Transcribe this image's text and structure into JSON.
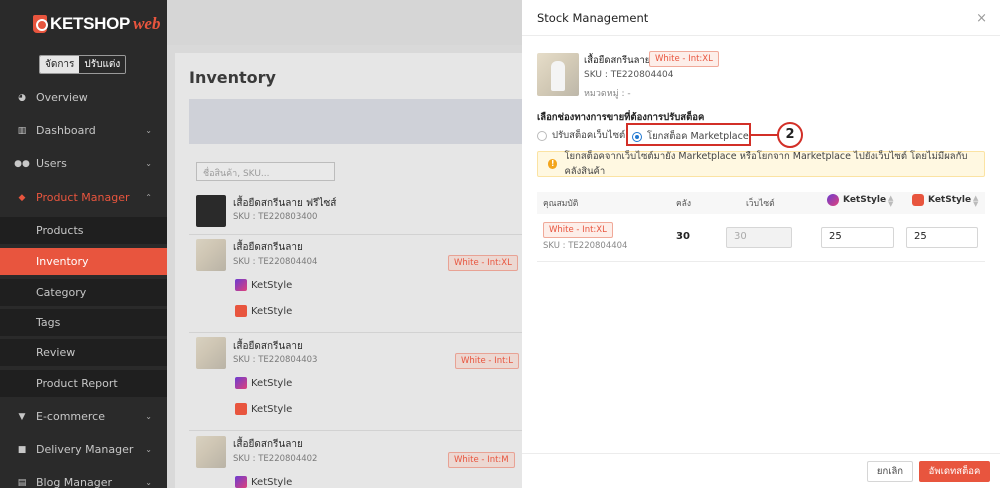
{
  "brand": {
    "name": "KETSHOP",
    "suffix": "web"
  },
  "mode_switch": {
    "manage": "จัดการ",
    "customize": "ปรับแต่ง"
  },
  "sidebar": {
    "items": [
      {
        "label": "Overview",
        "icon": "pie-chart-icon"
      },
      {
        "label": "Dashboard",
        "icon": "bar-chart-icon",
        "chevron": "⌄"
      },
      {
        "label": "Users",
        "icon": "users-icon",
        "chevron": "⌄"
      },
      {
        "label": "Product Manager",
        "icon": "tag-icon",
        "chevron": "⌃"
      },
      {
        "label": "E-commerce",
        "icon": "cart-icon",
        "chevron": "⌄"
      },
      {
        "label": "Delivery Manager",
        "icon": "truck-icon",
        "chevron": "⌄"
      },
      {
        "label": "Blog Manager",
        "icon": "blog-icon",
        "chevron": "⌄"
      }
    ],
    "sub_items": [
      "Products",
      "Inventory",
      "Category",
      "Tags",
      "Review",
      "Product Report"
    ]
  },
  "inventory": {
    "title": "Inventory",
    "search_placeholder": "ชื่อสินค้า, SKU...",
    "rows": [
      {
        "name": "เสื้อยืดสกรีนลาย ฟรีไซส์",
        "sku": "SKU : TE220803400",
        "tag": ""
      },
      {
        "name": "เสื้อยืดสกรีนลาย",
        "sku": "SKU : TE220804404",
        "tag": "White - Int:XL"
      },
      {
        "name": "เสื้อยืดสกรีนลาย",
        "sku": "SKU : TE220804403",
        "tag": "White - Int:L"
      },
      {
        "name": "เสื้อยืดสกรีนลาย",
        "sku": "SKU : TE220804402",
        "tag": "White - Int:M"
      }
    ],
    "marketplace": "KetStyle"
  },
  "panel": {
    "title": "Stock Management",
    "close": "×",
    "product_name": "เสื้อยืดสกรีนลาย",
    "product_tag": "White - Int:XL",
    "sku": "SKU : TE220804404",
    "category": "หมวดหมู่ : -",
    "section_label": "เลือกช่องทางการขายที่ต้องการปรับสต็อค",
    "option_website": "ปรับสต็อคเว็บไซต์",
    "option_marketplace": "โยกสต็อค Marketplace",
    "annotation_number": "2",
    "warning": "โยกสต็อคจากเว็บไซต์มายัง Marketplace หรือโยกจาก Marketplace ไปยังเว็บไซต์ โดยไม่มีผลกับคลังสินค้า",
    "columns": {
      "attribute": "คุณสมบัติ",
      "stock": "คลัง",
      "website": "เว็บไซต์",
      "mp1": "KetStyle",
      "mp2": "KetStyle"
    },
    "row": {
      "tag": "White - Int:XL",
      "sku": "SKU : TE220804404",
      "stock": "30",
      "website": "30",
      "mp1": "25",
      "mp2": "25"
    },
    "cancel": "ยกเลิก",
    "save": "อัพเดทสต็อค"
  },
  "colors": {
    "accent": "#e8553e",
    "sidebar": "#2a2a2a",
    "highlight": "#d22f27",
    "radio": "#1f77d0"
  }
}
